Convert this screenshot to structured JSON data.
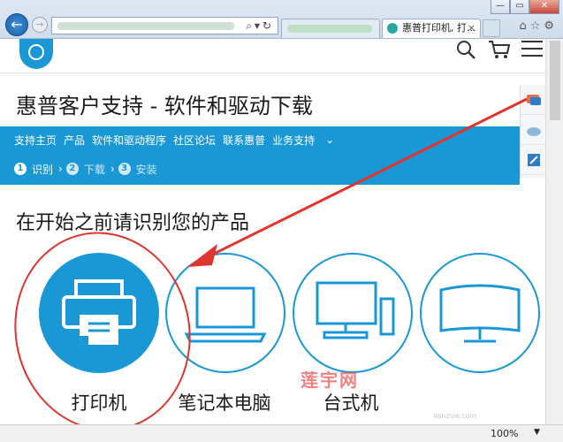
{
  "browser": {
    "tabs": [
      {
        "label": ""
      },
      {
        "label": "惠普打印机, 打..."
      }
    ],
    "window_buttons": [
      "—",
      "▭",
      "✕"
    ]
  },
  "page": {
    "title": "惠普客户支持 - 软件和驱动下载",
    "nav": [
      "支持主页",
      "产品",
      "软件和驱动程序",
      "社区论坛",
      "联系惠普",
      "业务支持"
    ],
    "steps": [
      {
        "num": "1",
        "label": "识别"
      },
      {
        "num": "2",
        "label": "下载"
      },
      {
        "num": "3",
        "label": "安装"
      }
    ],
    "identify_heading": "在开始之前请识别您的产品",
    "categories": [
      {
        "label": "打印机",
        "icon": "printer-icon"
      },
      {
        "label": "笔记本电脑",
        "icon": "laptop-icon"
      },
      {
        "label": "台式机",
        "icon": "desktop-icon"
      },
      {
        "label": "",
        "icon": "monitor-icon"
      }
    ]
  },
  "watermark": "莲宇网",
  "watermark_url": "lianzuw.com",
  "status": {
    "zoom": "100%"
  },
  "colors": {
    "accent": "#1a98d5",
    "annotation": "#e0342f"
  }
}
